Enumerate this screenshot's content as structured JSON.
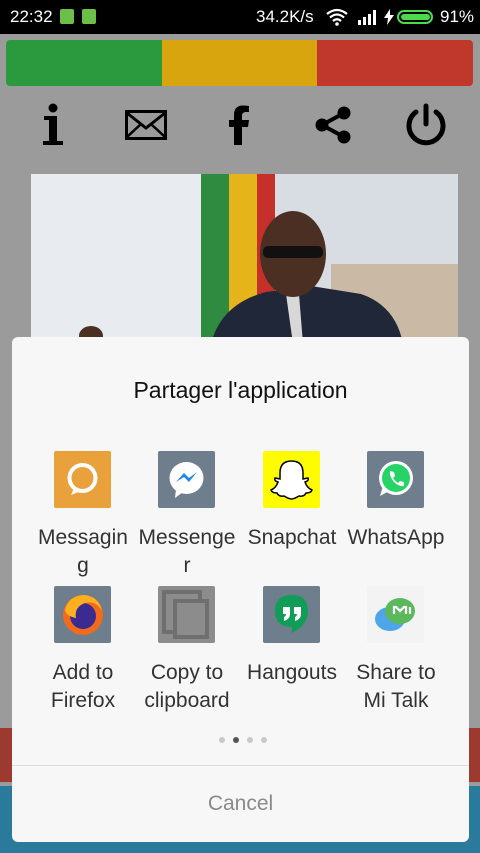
{
  "status_bar": {
    "time": "22:32",
    "network_speed": "34.2K/s",
    "battery_percent": "91%",
    "battery_level": 0.91
  },
  "flag_colors": [
    "#2b9a3f",
    "#d9a50f",
    "#c0372c"
  ],
  "toolbar": {
    "icons": [
      "info-icon",
      "mail-icon",
      "facebook-icon",
      "share-icon",
      "power-icon"
    ]
  },
  "share_dialog": {
    "title": "Partager  l'application",
    "items": [
      {
        "label": "Messagin\ng",
        "icon": "messaging-icon",
        "color": "#e9a13b"
      },
      {
        "label": "Messenge\nr",
        "icon": "messenger-icon",
        "color": "#1e88e5"
      },
      {
        "label": "Snapchat",
        "icon": "snapchat-icon",
        "color": "#fffc00"
      },
      {
        "label": "WhatsApp",
        "icon": "whatsapp-icon",
        "color": "#25d366"
      },
      {
        "label": "Add to\nFirefox",
        "icon": "firefox-icon",
        "color": "#e66000"
      },
      {
        "label": "Copy to\nclipboard",
        "icon": "clipboard-icon",
        "color": "#777777"
      },
      {
        "label": "Hangouts",
        "icon": "hangouts-icon",
        "color": "#0f9d58"
      },
      {
        "label": "Share to\nMi Talk",
        "icon": "mitalk-icon",
        "color": "#4caf50"
      }
    ],
    "page_count": 4,
    "current_page": 2,
    "cancel_label": "Cancel"
  }
}
